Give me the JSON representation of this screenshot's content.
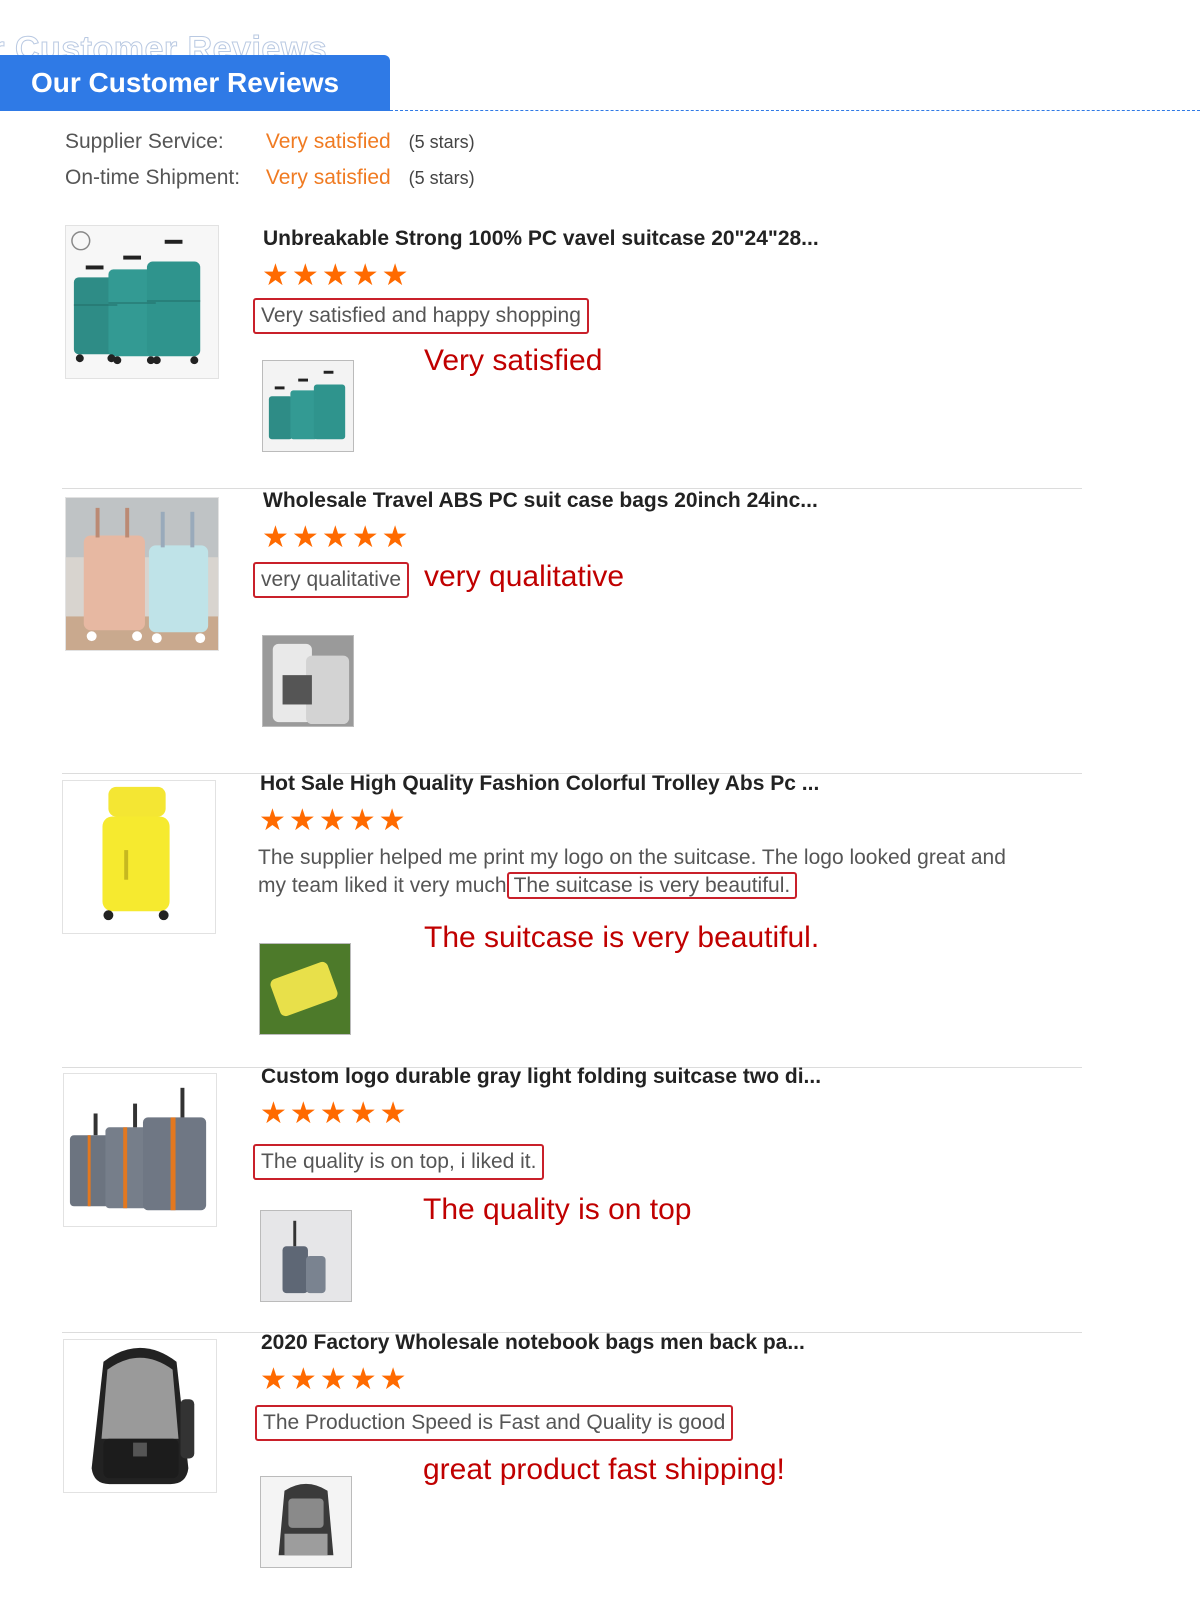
{
  "header": {
    "title": "Our Customer Reviews",
    "title_shadow": "ur Customer Reviews"
  },
  "summary": [
    {
      "label": "Supplier Service:",
      "value": "Very satisfied",
      "stars": "(5 stars)"
    },
    {
      "label": "On-time Shipment:",
      "value": "Very satisfied",
      "stars": "(5 stars)"
    }
  ],
  "star_glyph": "★",
  "colors": {
    "accent": "#2f7ae6",
    "star": "#ff6a00",
    "highlight": "#c00000",
    "value": "#f07b22"
  },
  "reviews": [
    {
      "title": "Unbreakable Strong 100% PC vavel suitcase 20\"24\"28...",
      "rating": 5,
      "comment": "Very satisfied and happy shopping",
      "annotation": "Very satisfied",
      "product_icon": "teal-suitcase-set",
      "photo_icon": "teal-suitcase-set"
    },
    {
      "title": "Wholesale Travel ABS PC suit case bags 20inch 24inc...",
      "rating": 5,
      "comment": "very qualitative",
      "annotation": "very qualitative",
      "product_icon": "pink-blue-suitcases",
      "photo_icon": "white-suitcases"
    },
    {
      "title": "Hot Sale High Quality Fashion Colorful Trolley Abs Pc ...",
      "rating": 5,
      "comment_before": "The supplier helped me print my logo on the suitcase. The logo looked great and my team liked it very much",
      "comment_boxed": "The suitcase is very beautiful.",
      "annotation": "The suitcase is very beautiful.",
      "product_icon": "yellow-suitcase",
      "photo_icon": "yellow-suitcase-on-grass"
    },
    {
      "title": "Custom logo durable gray light folding suitcase two di...",
      "rating": 5,
      "comment": "The quality is on top, i liked it.",
      "annotation": "The quality is on top",
      "product_icon": "gray-suitcase-set",
      "photo_icon": "gray-suitcases"
    },
    {
      "title": "2020 Factory Wholesale notebook bags men back pa...",
      "rating": 5,
      "comment": "The Production Speed is Fast and Quality is good",
      "annotation": "great product fast shipping!",
      "product_icon": "gray-backpack",
      "photo_icon": "gray-backpack-open"
    }
  ]
}
